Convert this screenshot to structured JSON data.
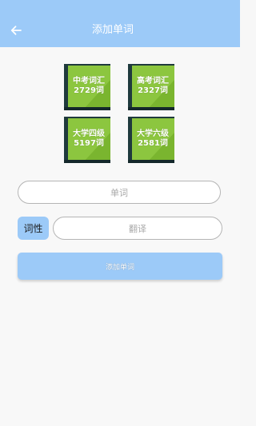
{
  "header": {
    "title": "添加单词",
    "back_icon": "arrow-left-icon"
  },
  "books": [
    {
      "name": "中考词汇",
      "count": "2729词"
    },
    {
      "name": "高考词汇",
      "count": "2327词"
    },
    {
      "name": "大学四级",
      "count": "5197词"
    },
    {
      "name": "大学六级",
      "count": "2581词"
    }
  ],
  "form": {
    "word_placeholder": "单词",
    "pos_label": "词性",
    "translation_placeholder": "翻译",
    "submit_label": "添加单词"
  },
  "colors": {
    "accent": "#9ccaf8",
    "book_green": "#8cc63f",
    "book_spine": "#1f3a3d"
  }
}
